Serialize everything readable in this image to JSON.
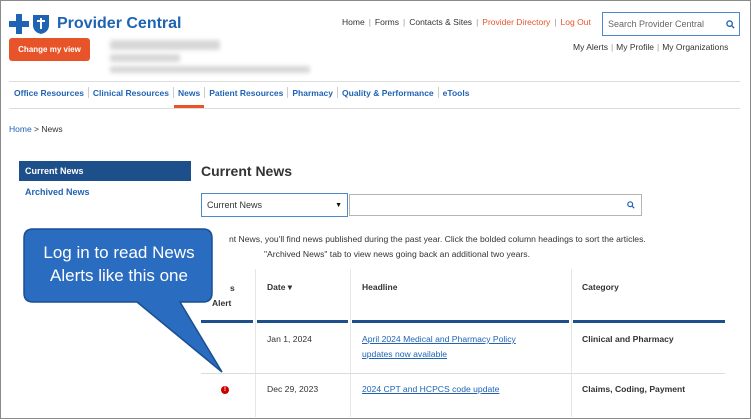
{
  "brand": {
    "name": "Provider Central",
    "accent": "#e8542a",
    "primary": "#1f63b4",
    "navy": "#1d4f8a"
  },
  "header": {
    "change_view_label": "Change my view",
    "top_links": [
      {
        "label": "Home",
        "accent": false
      },
      {
        "label": "Forms",
        "accent": false
      },
      {
        "label": "Contacts & Sites",
        "accent": false
      },
      {
        "label": "Provider Directory",
        "accent": true
      },
      {
        "label": "Log Out",
        "accent": true
      }
    ],
    "search_placeholder": "Search Provider Central",
    "account_links": [
      "My Alerts",
      "My Profile",
      "My Organizations"
    ]
  },
  "nav": {
    "items": [
      "Office Resources",
      "Clinical Resources",
      "News",
      "Patient Resources",
      "Pharmacy",
      "Quality & Performance",
      "eTools"
    ],
    "active": "News"
  },
  "breadcrumb": {
    "home": "Home",
    "separator": " > ",
    "current": "News"
  },
  "sidebar": {
    "current": "Current News",
    "archived": "Archived News"
  },
  "main": {
    "title": "Current News",
    "select_value": "Current News",
    "intro_line1": "nt News, you'll find news published during the past year. Click the bolded column headings to sort the articles.",
    "intro_line2": "\"Archived News\" tab to view news going back an additional two years.",
    "table": {
      "headers": {
        "alert_1": "s",
        "alert_2": "Alert",
        "date": "Date ▾",
        "headline": "Headline",
        "category": "Category"
      },
      "rows": [
        {
          "alert": false,
          "date": "Jan 1, 2024",
          "headline_1": "April 2024 Medical and Pharmacy Policy",
          "headline_2": "updates now available",
          "category": "Clinical and Pharmacy"
        },
        {
          "alert": true,
          "date": "Dec 29, 2023",
          "headline_1": "2024 CPT and HCPCS code update",
          "headline_2": "",
          "category": "Claims, Coding, Payment"
        }
      ]
    }
  },
  "callout": {
    "line1": "Log in to read News",
    "line2": "Alerts like this one",
    "fill": "#2a6cc0"
  },
  "icons": {
    "logo": "cross-shield-logo-icon",
    "search": "search-icon",
    "select_arrow": "caret-down-icon",
    "alert": "alert-icon"
  }
}
